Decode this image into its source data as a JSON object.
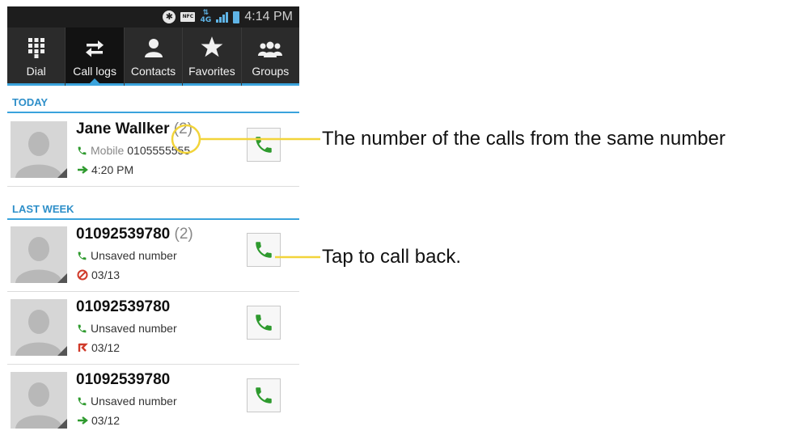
{
  "status_bar": {
    "time": "4:14 PM",
    "nfc_label": "NFC",
    "network_label": "4G",
    "icons": [
      "bluetooth-icon",
      "nfc-icon",
      "4g-icon",
      "signal-icon",
      "battery-icon"
    ]
  },
  "tabs": [
    {
      "label": "Dial",
      "icon": "dialpad-icon",
      "active": false
    },
    {
      "label": "Call logs",
      "icon": "call-logs-icon",
      "active": true
    },
    {
      "label": "Contacts",
      "icon": "contact-icon",
      "active": false
    },
    {
      "label": "Favorites",
      "icon": "star-icon",
      "active": false
    },
    {
      "label": "Groups",
      "icon": "groups-icon",
      "active": false
    }
  ],
  "sections": [
    {
      "title": "TODAY",
      "entries": [
        {
          "name": "Jane Wallker",
          "count": "(2)",
          "type": "Mobile",
          "number": "0105555555",
          "time": "4:20 PM",
          "status_icon": "outgoing-arrow-icon"
        }
      ]
    },
    {
      "title": "LAST WEEK",
      "entries": [
        {
          "name": "01092539780",
          "count": "(2)",
          "type": "",
          "number": "Unsaved number",
          "time": "03/13",
          "status_icon": "rejected-call-icon"
        },
        {
          "name": "01092539780",
          "count": "",
          "type": "",
          "number": "Unsaved number",
          "time": "03/12",
          "status_icon": "missed-call-icon"
        },
        {
          "name": "01092539780",
          "count": "",
          "type": "",
          "number": "Unsaved number",
          "time": "03/12",
          "status_icon": "outgoing-arrow-icon"
        }
      ]
    }
  ],
  "annotations": {
    "count_note": "The number of the calls from the same number",
    "callback_note": "Tap to call back."
  },
  "colors": {
    "accent": "#3aa3dc",
    "call_green": "#2e9a2e",
    "highlight_circle": "#f2d43a",
    "rejected_red": "#d03a2a"
  }
}
